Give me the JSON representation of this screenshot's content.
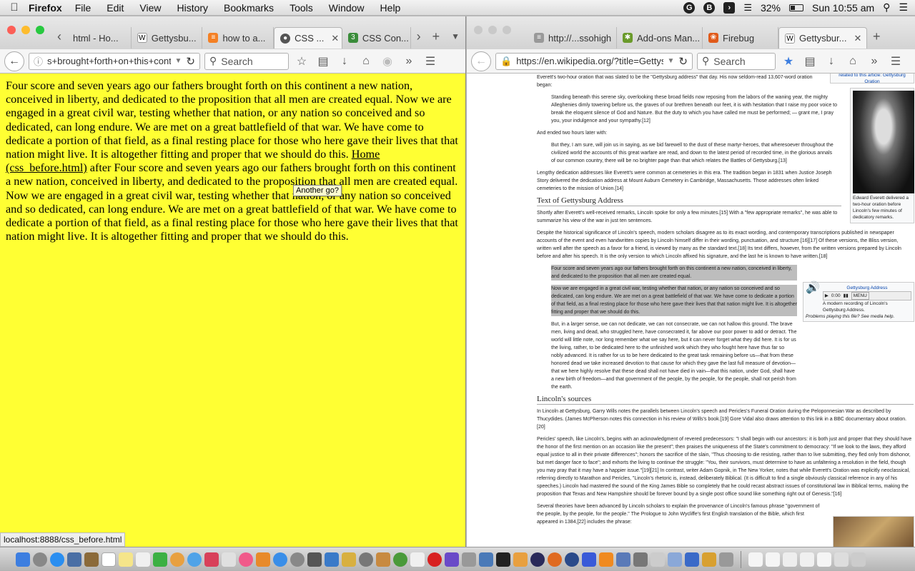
{
  "menubar": {
    "app": "Firefox",
    "items": [
      "File",
      "Edit",
      "View",
      "History",
      "Bookmarks",
      "Tools",
      "Window",
      "Help"
    ],
    "battery": "32%",
    "clock": "Sun 10:55 am"
  },
  "left_window": {
    "tabs": [
      {
        "label": "html - Ho...",
        "icon": "page-icon"
      },
      {
        "label": "Gettysbu...",
        "icon": "wikipedia-icon"
      },
      {
        "label": "how to a...",
        "icon": "stackoverflow-icon"
      },
      {
        "label": "CSS ...",
        "icon": "globe-icon",
        "active": true
      },
      {
        "label": "CSS Con...",
        "icon": "w3c-icon"
      }
    ],
    "url": "s+brought+forth+on+this+contir",
    "search_placeholder": "Search",
    "paragraph_part1": "Four score and seven years ago our fathers brought forth on this continent a new nation, conceived in liberty, and dedicated to the proposition that all men are created equal. Now we are engaged in a great civil war, testing whether that nation, or any nation so conceived and so dedicated, can long endure. We are met on a great battlefield of that war. We have come to dedicate a portion of that field, as a final resting place for those who here gave their lives that that nation might live. It is altogether fitting and proper that we should do this. ",
    "link_text": "Home (css_before.html)",
    "paragraph_part2": " after Four score and seven years ago our fathers brought forth on this continent a new nation, conceived in liberty, and dedicated to the proposition that all men are created equal. Now we are engaged in a great civil war, testing whether that nation, or any nation so conceived and so dedicated, can long endure. We are met on a great battlefield of that war. We have come to dedicate a portion of that field, as a final resting place for those who here gave their lives that that nation might live. It is altogether fitting and proper that we should do this.",
    "tooltip": "Another go?",
    "status": "localhost:8888/css_before.html"
  },
  "right_window": {
    "tabs": [
      {
        "label": "http://...ssohigh",
        "icon": "page-icon"
      },
      {
        "label": "Add-ons Man...",
        "icon": "puzzle-icon"
      },
      {
        "label": "Firebug",
        "icon": "firebug-icon"
      },
      {
        "label": "Gettysbur...",
        "icon": "wikipedia-icon",
        "active": true
      }
    ],
    "url": "https://en.wikipedia.org/?title=Gettyst",
    "search_placeholder": "Search",
    "wiki": {
      "intro": "Everett's two-hour oration that was slated to be the \"Gettysburg address\" that day. His now seldom-read 13,607-word oration began:",
      "quote1": "Standing beneath this serene sky, overlooking these broad fields now reposing from the labors of the waning year, the mighty Alleghenies dimly towering before us, the graves of our brethren beneath our feet, it is with hesitation that I raise my poor voice to break the eloquent silence of God and Nature. But the duty to which you have called me must be performed; — grant me, I pray you, your indulgence and your sympathy.[12]",
      "ended": "And ended two hours later with:",
      "quote2": "But they, I am sure, will join us in saying, as we bid farewell to the dust of these martyr-heroes, that wheresoever throughout the civilized world the accounts of this great warfare are read, and down to the latest period of recorded time, in the glorious annals of our common country, there will be no brighter page than that which relates the Battles of Gettysburg.[13]",
      "lengthy": "Lengthy dedication addresses like Everett's were common at cemeteries in this era. The tradition began in 1831 when Justice Joseph Story delivered the dedication address at Mount Auburn Cemetery in Cambridge, Massachusetts. Those addresses often linked cemeteries to the mission of Union.[14]",
      "heading1": "Text of Gettysburg Address",
      "text1": "Shortly after Everett's well-received remarks, Lincoln spoke for only a few minutes.[15] With a \"few appropriate remarks\", he was able to summarize his view of the war in just ten sentences.",
      "text2": "Despite the historical significance of Lincoln's speech, modern scholars disagree as to its exact wording, and contemporary transcriptions published in newspaper accounts of the event and even handwritten copies by Lincoln himself differ in their wording, punctuation, and structure.[16][17] Of these versions, the Bliss version, written well after the speech as a favor for a friend, is viewed by many as the standard text.[18] Its text differs, however, from the written versions prepared by Lincoln before and after his speech. It is the only version to which Lincoln affixed his signature, and the last he is known to have written.[18]",
      "hl1": "Four score and seven years ago our fathers brought forth on this continent a new nation, conceived in liberty, and dedicated to the proposition that all men are created equal.",
      "hl2": "Now we are engaged in a great civil war, testing whether that nation, or any nation so conceived and so dedicated, can long endure. We are met on a great battlefield of that war. We have come to dedicate a portion of that field, as a final resting place for those who here gave their lives that that nation might live. It is altogether fitting and proper that we should do this.",
      "plain": "But, in a larger sense, we can not dedicate, we can not consecrate, we can not hallow this ground. The brave men, living and dead, who struggled here, have consecrated it, far above our poor power to add or detract. The world will little note, nor long remember what we say here, but it can never forget what they did here. It is for us the living, rather, to be dedicated here to the unfinished work which they who fought here have thus far so nobly advanced. It is rather for us to be here dedicated to the great task remaining before us—that from these honored dead we take increased devotion to that cause for which they gave the last full measure of devotion—that we here highly resolve that these dead shall not have died in vain—that this nation, under God, shall have a new birth of freedom—and that government of the people, by the people, for the people, shall not perish from the earth.",
      "heading2": "Lincoln's sources",
      "sources1": "In Lincoln at Gettysburg, Garry Wills notes the parallels between Lincoln's speech and Pericles's Funeral Oration during the Peloponnesian War as described by Thucydides. (James McPherson notes this connection in his review of Wills's book.[19] Gore Vidal also draws attention to this link in a BBC documentary about oration.[20]",
      "sources2": "Pericles' speech, like Lincoln's, begins with an acknowledgment of revered predecessors: \"I shall begin with our ancestors: it is both just and proper that they should have the honor of the first mention on an occasion like the present\"; then praises the uniqueness of the State's commitment to democracy: \"If we look to the laws, they afford equal justice to all in their private differences\"; honors the sacrifice of the slain, \"Thus choosing to die resisting, rather than to live submitting, they fled only from dishonor, but met danger face to face\"; and exhorts the living to continue the struggle: \"You, their survivors, must determine to have as unfaltering a resolution in the field, though you may pray that it may have a happier issue.\"[19][21] In contrast, writer Adam Gopnik, in The New Yorker, notes that while Everett's Oration was explicitly neoclassical, referring directly to Marathon and Pericles, \"Lincoln's rhetoric is, instead, deliberately Biblical. (It is difficult to find a single obviously classical reference in any of his speeches.) Lincoln had mastered the sound of the King James Bible so completely that he could recast abstract issues of constitutional law in Biblical terms, making the proposition that Texas and New Hampshire should be forever bound by a single post office sound like something right out of Genesis.\"[16]",
      "sources3": "Several theories have been advanced by Lincoln scholars to explain the provenance of Lincoln's famous phrase \"government of the people, by the people, for the people.\" The Prologue to John Wycliffe's first English translation of the Bible, which first appeared in 1384,[22] includes the phrase:",
      "thumb_top": "related to this article: Gettysburg Oration",
      "portrait_caption": "Edward Everett delivered a two-hour oration before Lincoln's few minutes of dedicatory remarks.",
      "audio_title": "Gettysburg Address",
      "audio_time": "0:00",
      "audio_menu": "MENU",
      "audio_desc": "A modern recording of Lincoln's Gettysburg Address.",
      "audio_help": "Problems playing this file? See media help."
    }
  }
}
